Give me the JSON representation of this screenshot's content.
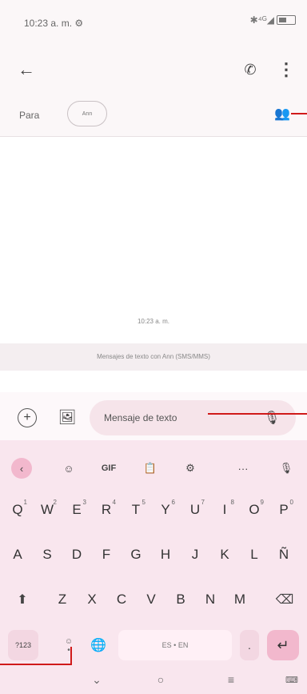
{
  "status_bar": {
    "time": "10:23 a. m. ⚙",
    "icons": "✱⁴ᴳ◢",
    "battery_label": ""
  },
  "app_bar": {
    "back": "←",
    "call": "✆",
    "more": "⋮"
  },
  "recipients": {
    "to_label": "Para",
    "chip": "Ann",
    "add_people": "👥"
  },
  "conversation": {
    "timestamp": "10:23 a. m.",
    "system_message": "Mensajes de texto con Ann (SMS/MMS)"
  },
  "composer": {
    "add": "+",
    "gallery": "🖼",
    "placeholder": "Mensaje de texto",
    "mic": "🎙"
  },
  "keyboard": {
    "toolbar": [
      "‹",
      "☺",
      "GIF",
      "📋",
      "⚙",
      "···",
      "🎙"
    ],
    "row1": [
      {
        "key": "Q",
        "sup": "1"
      },
      {
        "key": "W",
        "sup": "2"
      },
      {
        "key": "E",
        "sup": "3"
      },
      {
        "key": "R",
        "sup": "4"
      },
      {
        "key": "T",
        "sup": "5"
      },
      {
        "key": "Y",
        "sup": "6"
      },
      {
        "key": "U",
        "sup": "7"
      },
      {
        "key": "I",
        "sup": "8"
      },
      {
        "key": "O",
        "sup": "9"
      },
      {
        "key": "P",
        "sup": "0"
      }
    ],
    "row2": [
      "A",
      "S",
      "D",
      "F",
      "G",
      "H",
      "J",
      "K",
      "L",
      "Ñ"
    ],
    "row3": [
      "Z",
      "X",
      "C",
      "V",
      "B",
      "N",
      "M"
    ],
    "shift": "⬆",
    "backspace": "⌫",
    "numbers": "?123",
    "emoji_dots": "☺\n•",
    "globe": "🌐",
    "space": "ES • EN",
    "period": ".",
    "enter": "↵"
  },
  "nav": {
    "back": "⌄",
    "home": "○",
    "recents": "≡",
    "keyboard": "⌨"
  },
  "colors": {
    "accent": "#f2b8cd",
    "callout": "#d01a1a",
    "keyboard_bg": "#f9e6ee"
  }
}
